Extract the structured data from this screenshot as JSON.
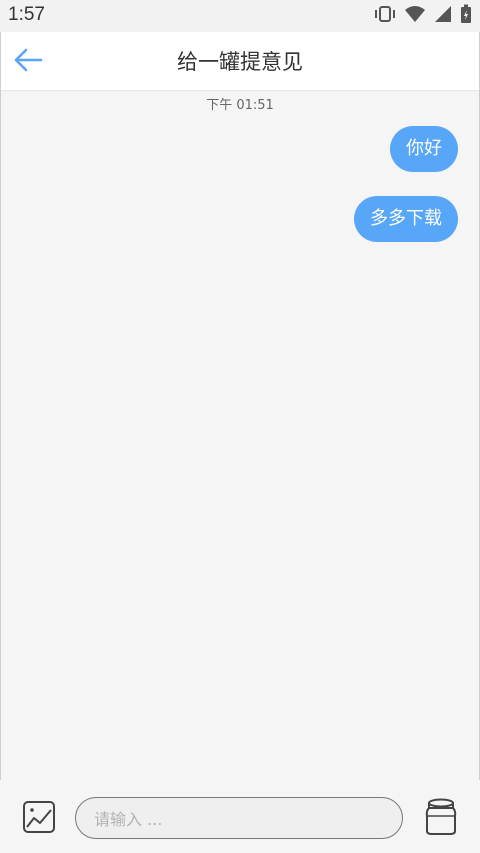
{
  "status_bar": {
    "time": "1:57"
  },
  "header": {
    "title": "给一罐提意见"
  },
  "chat": {
    "timestamp": "下午 01:51",
    "messages": [
      {
        "text": "你好",
        "sender": "user"
      },
      {
        "text": "多多下载",
        "sender": "user"
      }
    ]
  },
  "input_bar": {
    "placeholder": "请输入 ..."
  },
  "colors": {
    "accent": "#58a6f7",
    "background": "#f5f5f5"
  },
  "icons": {
    "back": "back-arrow-icon",
    "image": "image-icon",
    "jar": "jar-icon"
  }
}
